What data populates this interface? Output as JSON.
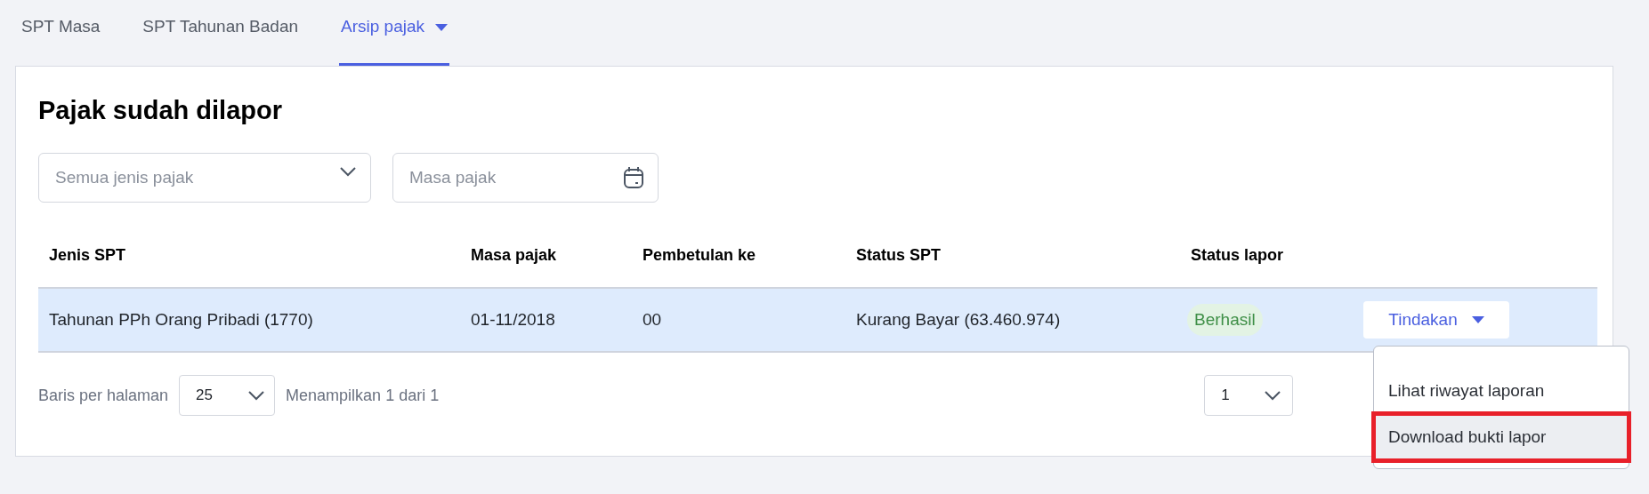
{
  "tabs": [
    {
      "label": "SPT Masa",
      "selected": false,
      "kind": "plain"
    },
    {
      "label": "SPT Tahunan Badan",
      "selected": false,
      "kind": "plain"
    },
    {
      "label": "Arsip pajak",
      "selected": true,
      "kind": "dropdown"
    }
  ],
  "title": "Pajak sudah dilapor",
  "filters": [
    {
      "kind": "select",
      "placeholder": "Semua jenis pajak"
    },
    {
      "kind": "date",
      "placeholder": "Masa pajak"
    }
  ],
  "table": {
    "columns": [
      "Jenis SPT",
      "Masa pajak",
      "Pembetulan ke",
      "Status SPT",
      "Status lapor"
    ],
    "rows": [
      {
        "selected": true,
        "cells": [
          "Tahunan PPh Orang Pribadi (1770)",
          "01-11/2018",
          "00",
          "Kurang Bayar (63.460.974)"
        ],
        "status": "Berhasil",
        "action": "Tindakan"
      }
    ]
  },
  "pagination": {
    "rows_label": "Baris per halaman",
    "rows_per_page": "25",
    "summary": "Menampilkan 1 dari 1",
    "page": "1"
  },
  "action_menu": [
    {
      "label": "Lihat riwayat laporan",
      "highlighted": false
    },
    {
      "label": "Download bukti lapor",
      "highlighted": true
    }
  ]
}
